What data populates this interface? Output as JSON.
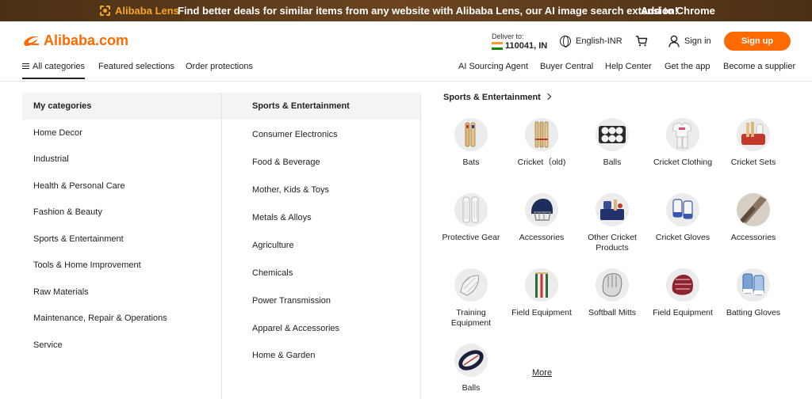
{
  "banner": {
    "lens_name": "Alibaba Lens",
    "message": "Find better deals for similar items from any website with Alibaba Lens, our AI image search extension!",
    "cta": "Add to Chrome"
  },
  "header": {
    "logo_text": "Alibaba.com",
    "deliver_label": "Deliver to:",
    "deliver_zip": "110041, IN",
    "language": "English-INR",
    "sign_in": "Sign in",
    "sign_up": "Sign up"
  },
  "nav": {
    "left": [
      "All categories",
      "Featured selections",
      "Order protections"
    ],
    "right": [
      "AI Sourcing Agent",
      "Buyer Central",
      "Help Center",
      "Get the app",
      "Become a supplier"
    ]
  },
  "my_categories": {
    "title": "My categories",
    "items": [
      "Home Decor",
      "Industrial",
      "Health & Personal Care",
      "Fashion & Beauty",
      "Sports & Entertainment",
      "Tools & Home Improvement",
      "Raw Materials",
      "Maintenance, Repair & Operations",
      "Service"
    ]
  },
  "sub_categories": {
    "title": "Sports & Entertainment",
    "items": [
      "Consumer Electronics",
      "Food & Beverage",
      "Mother, Kids & Toys",
      "Metals & Alloys",
      "Agriculture",
      "Chemicals",
      "Power Transmission",
      "Apparel & Accessories",
      "Home & Garden"
    ]
  },
  "section": {
    "title": "Sports & Entertainment",
    "tiles": [
      {
        "label": "Bats",
        "icon": "cricket-bats-icon"
      },
      {
        "label": "Cricket（old)",
        "icon": "cricket-bat-old-icon"
      },
      {
        "label": "Balls",
        "icon": "balls-box-icon"
      },
      {
        "label": "Cricket Clothing",
        "icon": "cricket-clothing-icon"
      },
      {
        "label": "Cricket Sets",
        "icon": "cricket-sets-icon"
      },
      {
        "label": "Protective Gear",
        "icon": "leg-pads-icon"
      },
      {
        "label": "Accessories",
        "icon": "helmet-icon"
      },
      {
        "label": "Other Cricket Products",
        "icon": "cricket-kit-icon"
      },
      {
        "label": "Cricket Gloves",
        "icon": "cricket-gloves-icon"
      },
      {
        "label": "Accessories",
        "icon": "bat-grip-icon"
      },
      {
        "label": "Training Equipment",
        "icon": "training-net-icon"
      },
      {
        "label": "Field Equipment",
        "icon": "stumps-icon"
      },
      {
        "label": "Softball Mitts",
        "icon": "softball-mitt-icon"
      },
      {
        "label": "Field Equipment",
        "icon": "baseball-glove-icon"
      },
      {
        "label": "Batting Gloves",
        "icon": "batting-gloves-icon"
      },
      {
        "label": "Balls",
        "icon": "rugby-ball-icon"
      }
    ],
    "more": "More"
  },
  "colors": {
    "brand": "#ff6a00",
    "banner_bg": "#5a3a1a",
    "lens_accent": "#f5a623"
  }
}
